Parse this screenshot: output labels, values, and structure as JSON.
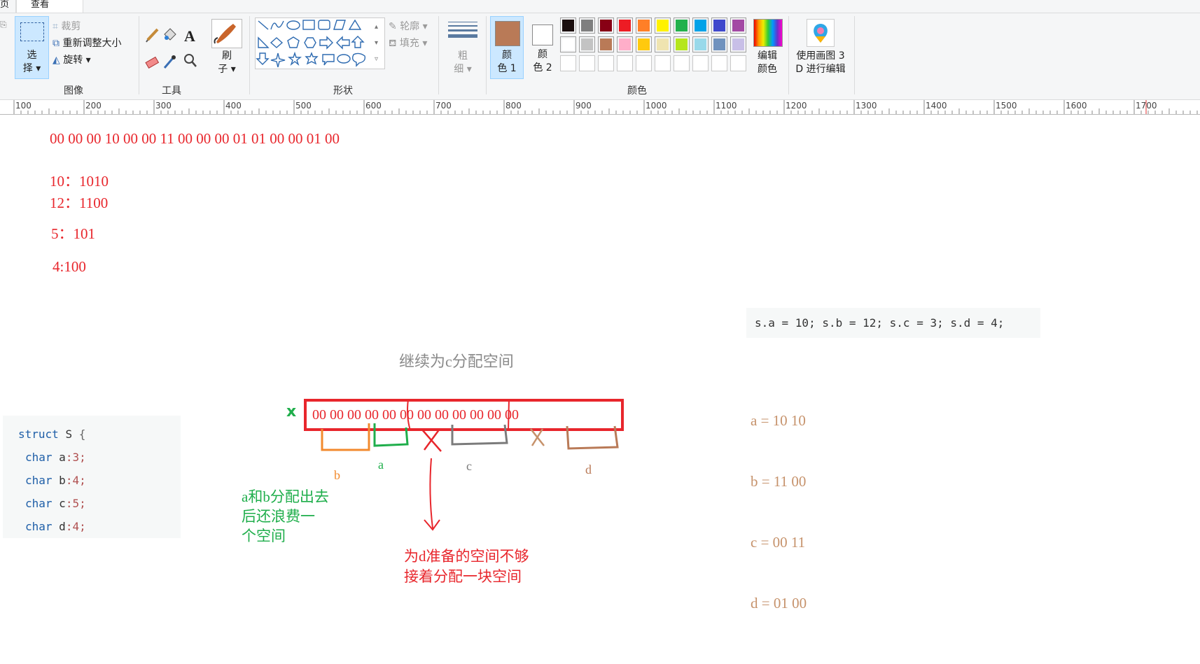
{
  "tabs": {
    "home": "页",
    "view": "查看"
  },
  "ribbon": {
    "image_group": {
      "select": "选",
      "select2": "择",
      "crop": "裁剪",
      "resize": "重新调整大小",
      "rotate": "旋转",
      "label": "图像"
    },
    "tools_group": {
      "label": "工具"
    },
    "brush": {
      "line1": "刷",
      "line2": "子"
    },
    "shapes_group": {
      "outline": "轮廓",
      "fill": "填充",
      "label": "形状"
    },
    "size": {
      "line1": "粗",
      "line2": "细"
    },
    "color1": {
      "line1": "颜",
      "line2": "色 1"
    },
    "color2": {
      "line1": "颜",
      "line2": "色 2"
    },
    "colors_group": {
      "label": "颜色"
    },
    "edit_colors": {
      "line1": "编辑",
      "line2": "颜色"
    },
    "paint3d": {
      "line1": "使用画图 3",
      "line2": "D 进行编辑"
    }
  },
  "palette": {
    "color1": "#b97a57",
    "color2": "#ffffff",
    "row1": [
      "#1b0f0f",
      "#7f7f7f",
      "#880015",
      "#ed1c24",
      "#ff7f27",
      "#fff200",
      "#22b14c",
      "#00a2e8",
      "#3f48cc",
      "#a349a4"
    ],
    "row2": [
      "#ffffff",
      "#c3c3c3",
      "#b97a57",
      "#ffaec9",
      "#ffc90e",
      "#efe4b0",
      "#b5e61d",
      "#99d9ea",
      "#7092be",
      "#c8bfe7"
    ]
  },
  "ruler": {
    "labels": [
      "100",
      "200",
      "300",
      "400",
      "500",
      "600",
      "700",
      "800",
      "900",
      "1000",
      "1100",
      "1200",
      "1300",
      "1400",
      "1500",
      "1600",
      "1700"
    ]
  },
  "canvas": {
    "bytes_line": "00  00  00  10    00  00  11  00     00  00  01  01     00  00  01  00",
    "bin10": "10：1010",
    "bin12": "12：1100",
    "bin5": "5：101",
    "bin4": "4:100",
    "title": "继续为c分配空间",
    "x_mark": "x",
    "memory_bytes": "00  00  00  00  00  00  00  00  00  00  00  00",
    "label_b": "b",
    "label_a": "a",
    "label_c": "c",
    "label_d": "d",
    "note_green": [
      "a和b分配出去",
      "后还浪费一",
      "个空间"
    ],
    "note_red": [
      "为d准备的空间不够",
      "接着分配一块空间"
    ]
  },
  "code_struct": {
    "line1": {
      "kw": "struct",
      "name": "S",
      "brace": "{"
    },
    "fields": [
      {
        "type": "char",
        "name": "a",
        "bits": ":3;"
      },
      {
        "type": "char",
        "name": "b",
        "bits": ":4;"
      },
      {
        "type": "char",
        "name": "c",
        "bits": ":5;"
      },
      {
        "type": "char",
        "name": "d",
        "bits": ":4;"
      }
    ]
  },
  "code_assign": "s.a = 10; s.b = 12; s.c = 3; s.d = 4;",
  "results": [
    "a = 10 10",
    "b = 11 00",
    "c = 00 11",
    "d = 01 00"
  ]
}
